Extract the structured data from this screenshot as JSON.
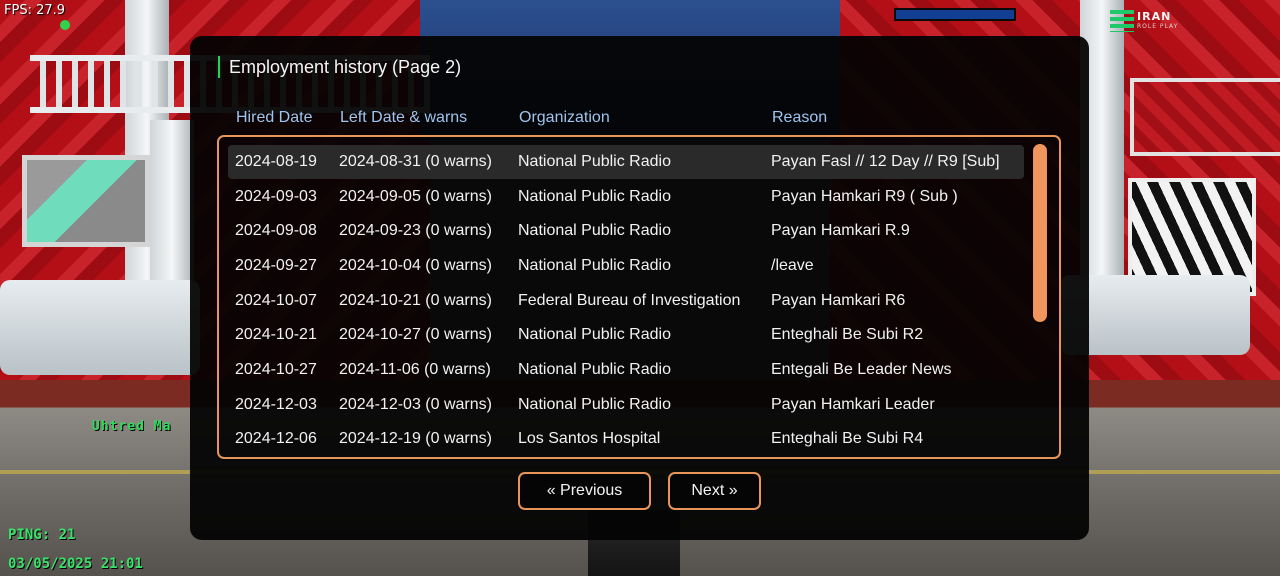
{
  "hud": {
    "fps": "FPS: 27.9",
    "server_logo": {
      "line1": "IRAN",
      "line2": "ROLE PLAY"
    },
    "player_name": "Uhtred Ma",
    "ping": "PING: 21",
    "datetime": "03/05/2025 21:01"
  },
  "dialog": {
    "title": "Employment history (Page 2)",
    "columns": [
      "Hired Date",
      "Left Date & warns",
      "Organization",
      "Reason"
    ],
    "rows": [
      {
        "hired": "2024-08-19",
        "left": "2024-08-31 (0 warns)",
        "org": "National Public Radio",
        "reason": "Payan Fasl // 12 Day // R9 [Sub]"
      },
      {
        "hired": "2024-09-03",
        "left": "2024-09-05 (0 warns)",
        "org": "National Public Radio",
        "reason": "Payan Hamkari R9 ( Sub )"
      },
      {
        "hired": "2024-09-08",
        "left": "2024-09-23 (0 warns)",
        "org": "National Public Radio",
        "reason": "Payan Hamkari R.9"
      },
      {
        "hired": "2024-09-27",
        "left": "2024-10-04 (0 warns)",
        "org": "National Public Radio",
        "reason": "/leave"
      },
      {
        "hired": "2024-10-07",
        "left": "2024-10-21 (0 warns)",
        "org": "Federal Bureau of Investigation",
        "reason": "Payan Hamkari R6"
      },
      {
        "hired": "2024-10-21",
        "left": "2024-10-27 (0 warns)",
        "org": "National Public Radio",
        "reason": "Enteghali Be Subi R2"
      },
      {
        "hired": "2024-10-27",
        "left": "2024-11-06 (0 warns)",
        "org": "National Public Radio",
        "reason": "Entegali Be Leader News"
      },
      {
        "hired": "2024-12-03",
        "left": "2024-12-03 (0 warns)",
        "org": "National Public Radio",
        "reason": "Payan Hamkari Leader"
      },
      {
        "hired": "2024-12-06",
        "left": "2024-12-19 (0 warns)",
        "org": "Los Santos Hospital",
        "reason": "Enteghali Be Subi R4"
      }
    ],
    "selected_row": 0,
    "buttons": {
      "previous": "« Previous",
      "next": "Next »"
    }
  },
  "colors": {
    "accent_border": "#e8955c",
    "header_text": "#9fc4ee",
    "hud_green": "#38e36a",
    "title_bar": "#2bd15a"
  }
}
